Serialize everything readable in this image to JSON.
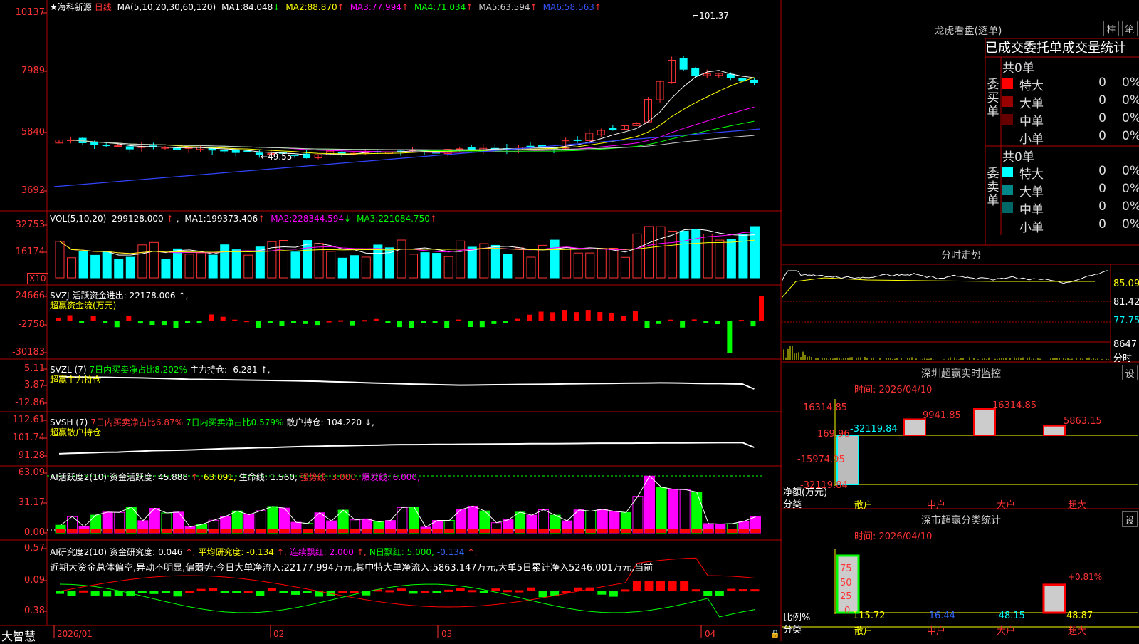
{
  "main": {
    "title": "★海科新源",
    "period": "日线",
    "ma_def": "MA(5,10,20,30,60,120)",
    "ma": [
      {
        "label": "MA1:",
        "value": "84.048",
        "arrow": "↓",
        "color": "#ffffff"
      },
      {
        "label": "MA2:",
        "value": "88.870",
        "arrow": "↑",
        "color": "#ffff00"
      },
      {
        "label": "MA3:",
        "value": "77.994",
        "arrow": "↑",
        "color": "#ff00ff"
      },
      {
        "label": "MA4:",
        "value": "71.034",
        "arrow": "↑",
        "color": "#00ff00"
      },
      {
        "label": "MA5:",
        "value": "63.594",
        "arrow": "↑",
        "color": "#cccccc"
      },
      {
        "label": "MA6:",
        "value": "58.563",
        "arrow": "↑",
        "color": "#3355ff"
      }
    ],
    "yticks": [
      "10137",
      "7989",
      "5840",
      "3692"
    ],
    "high_label": "101.37",
    "low_label": "49.55"
  },
  "vol": {
    "def": "VOL(5,10,20)",
    "value": "299128.000",
    "ma": [
      {
        "label": "MA1:",
        "value": "199373.406",
        "color": "#ffffff"
      },
      {
        "label": "MA2:",
        "value": "228344.594",
        "color": "#ff00ff"
      },
      {
        "label": "MA3:",
        "value": "221084.750",
        "color": "#00ff00"
      }
    ],
    "ma_arrows": [
      "↑",
      "↓",
      "↑"
    ],
    "arrow": "↑",
    "yticks": [
      "32753",
      "16174"
    ],
    "unit": "X10"
  },
  "svzj": {
    "def": "SVZJ",
    "label": "活跃资金进出:",
    "value": "22178.006",
    "arrow": "↑,",
    "sub": "超赢资金流(万元)",
    "yticks": [
      "24666",
      "-2758",
      "-30183"
    ]
  },
  "svzl": {
    "def": "SVZL (7)",
    "text1": "7日内买卖净占比8.202%",
    "label": "主力持仓:",
    "value": "-6.281",
    "arrow": "↑,",
    "sub": "超赢主力持仓",
    "yticks": [
      "5.11",
      "-3.87",
      "-12.86"
    ]
  },
  "svsh": {
    "def": "SVSH (7)",
    "text1": "7日内买卖净占比6.87%",
    "text2": "7日内买卖净占比0.579%",
    "label": "散户持仓:",
    "value": "104.220",
    "arrow": "↓,",
    "sub": "超赢散户持仓",
    "yticks": [
      "112.61",
      "101.74",
      "91.28"
    ]
  },
  "ai1": {
    "def": "AI活跃度2(10)",
    "label": "资金活跃度:",
    "value": "45.888",
    "arrow": "↑,",
    "v2": "63.091,",
    "life": "生命线: 1.560,",
    "strong": "强势线: 3.000,",
    "burst": "爆发线: 6.000,",
    "yticks": [
      "63.09",
      "31.17",
      "0.00"
    ]
  },
  "ai2": {
    "def": "AI研究度2(10)",
    "label": "资金研究度:",
    "value": "0.046",
    "arrow": "↑,",
    "avg": "平均研究度: -0.134",
    "avg_arrow": "↑,",
    "red1": "连续飘红: 2.000",
    "red1_arrow": "↑,",
    "red2": "N日飘红: 5.000,",
    "last": "-0.134",
    "last_arrow": "↑,",
    "comment": "近期大资金总体偏空,异动不明显,偏弱势,今日大单净流入:22177.994万元,其中特大单净流入:5863.147万元,大单5日累计净入5246.001万元,当前",
    "yticks": [
      "0.57",
      "0.09",
      "-0.38"
    ]
  },
  "xaxis": {
    "brand": "大智慧",
    "labels": [
      "2026/01",
      "02",
      "03",
      "04"
    ]
  },
  "orderbook": {
    "title": "龙虎看盘(逐单)",
    "btn1": "柱",
    "btn2": "笔",
    "subtitle": "已成交委托单成交量统计",
    "buy": {
      "side": "委买单",
      "count": "共0单",
      "rows": [
        {
          "label": "特大",
          "n": "0",
          "p": "0%",
          "color": "#ff0000"
        },
        {
          "label": "大单",
          "n": "0",
          "p": "0%",
          "color": "#990000"
        },
        {
          "label": "中单",
          "n": "0",
          "p": "0%",
          "color": "#660000"
        },
        {
          "label": "小单",
          "n": "0",
          "p": "0%",
          "color": ""
        }
      ]
    },
    "sell": {
      "side": "委卖单",
      "count": "共0单",
      "rows": [
        {
          "label": "特大",
          "n": "0",
          "p": "0%",
          "color": "#00ffff"
        },
        {
          "label": "大单",
          "n": "0",
          "p": "0%",
          "color": "#008888"
        },
        {
          "label": "中单",
          "n": "0",
          "p": "0%",
          "color": "#006666"
        },
        {
          "label": "小单",
          "n": "0",
          "p": "0%",
          "color": ""
        }
      ]
    }
  },
  "intraday": {
    "title": "分时走势",
    "yticks": [
      "85.09",
      "81.42",
      "77.75"
    ],
    "vol_tick": "8647",
    "unit": "分时"
  },
  "monitor": {
    "title": "深圳超赢实时监控",
    "btn": "设",
    "time": "时间: 2026/04/10",
    "yticks": [
      "16314.85",
      "169.96",
      "-15974.95",
      "-32119.84"
    ],
    "ylabel1": "净额(万元)",
    "ylabel2": "分类",
    "chart_data": {
      "type": "bar",
      "categories": [
        "散户",
        "中户",
        "大户",
        "超大"
      ],
      "values": [
        -32119.84,
        9941.85,
        16314.85,
        5863.15
      ],
      "labels": [
        "-32119.84",
        "9941.85",
        "16314.85",
        "5863.15"
      ]
    }
  },
  "stats": {
    "title": "深市超赢分类统计",
    "btn": "设",
    "time": "时间: 2026/04/10",
    "yticks": [
      "75",
      "50",
      "25",
      "0"
    ],
    "ylabel1": "比例%",
    "ylabel2": "分类",
    "bar_label": "+0.81%",
    "chart_data": {
      "type": "bar",
      "categories": [
        "散户",
        "中户",
        "大户",
        "超大"
      ],
      "values": [
        115.72,
        -16.44,
        -48.15,
        48.87
      ],
      "labels": [
        "115.72",
        "-16.44",
        "-48.15",
        "48.87"
      ]
    }
  },
  "colors": {
    "up": "#ff3333",
    "down": "#00ffff",
    "grid": "#b00000",
    "axis": "#ff3333"
  }
}
